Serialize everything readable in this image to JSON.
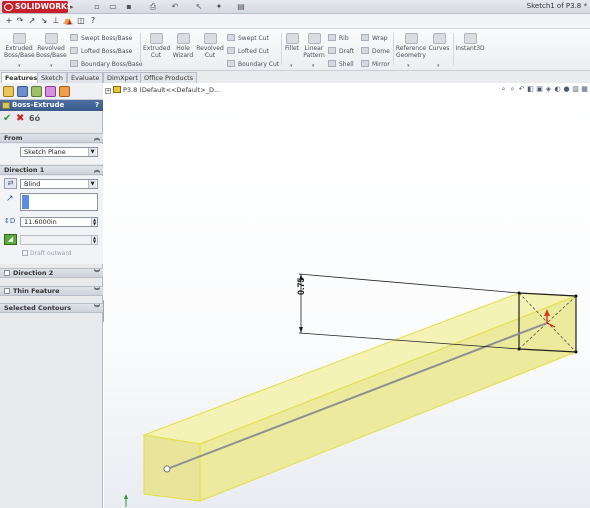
{
  "app": {
    "logo_text": "SOLIDWORKS",
    "document_title": "Sketch1 of P3.8 *",
    "brand_color": "#c8202a"
  },
  "quick_access": [
    {
      "icon": "new-document-icon",
      "glyph": "▫"
    },
    {
      "icon": "open-icon",
      "glyph": "▭"
    },
    {
      "icon": "save-icon",
      "glyph": "▪"
    },
    {
      "icon": "print-icon",
      "glyph": "⎙"
    },
    {
      "icon": "undo-icon",
      "glyph": "↶"
    },
    {
      "icon": "select-icon",
      "glyph": "↖"
    },
    {
      "icon": "rebuild-icon",
      "glyph": "✦"
    },
    {
      "icon": "options-icon",
      "glyph": "▤"
    }
  ],
  "toolbar2": [
    {
      "icon": "add-icon",
      "glyph": "+"
    },
    {
      "icon": "arc-icon",
      "glyph": "↷"
    },
    {
      "icon": "line-icon",
      "glyph": "↗"
    },
    {
      "icon": "trim-icon",
      "glyph": "↘"
    },
    {
      "icon": "dimension-icon",
      "glyph": "⊥"
    },
    {
      "icon": "view-icon",
      "glyph": "⛺"
    },
    {
      "icon": "appearance-icon",
      "glyph": "◫"
    },
    {
      "icon": "help-icon",
      "glyph": "?"
    }
  ],
  "ribbon": {
    "extruded_boss": "Extruded Boss/Base",
    "revolved_boss": "Revolved Boss/Base",
    "swept_boss": "Swept Boss/Base",
    "lofted_boss": "Lofted Boss/Base",
    "boundary_boss": "Boundary Boss/Base",
    "extruded_cut": "Extruded Cut",
    "hole_wizard": "Hole Wizard",
    "revolved_cut": "Revolved Cut",
    "swept_cut": "Swept Cut",
    "lofted_cut": "Lofted Cut",
    "boundary_cut": "Boundary Cut",
    "fillet": "Fillet",
    "linear_pattern": "Linear Pattern",
    "rib": "Rib",
    "draft": "Draft",
    "shell": "Shell",
    "wrap": "Wrap",
    "dome": "Dome",
    "mirror": "Mirror",
    "reference_geometry": "Reference Geometry",
    "curves": "Curves",
    "instant3d": "Instant3D"
  },
  "tabs": [
    "Features",
    "Sketch",
    "Evaluate",
    "DimXpert",
    "Office Products"
  ],
  "active_tab": "Features",
  "property_manager": {
    "title": "Boss-Extrude",
    "help": "?",
    "ok": "✔",
    "cancel": "✖",
    "preview": "6ó",
    "from": {
      "header": "From",
      "value": "Sketch Plane"
    },
    "direction1": {
      "header": "Direction 1",
      "end_condition": "Blind",
      "depth": "11.6000in",
      "draft_outward": "Draft outward"
    },
    "direction2": {
      "header": "Direction 2"
    },
    "thin_feature": {
      "header": "Thin Feature"
    },
    "selected_contours": {
      "header": "Selected Contours"
    }
  },
  "graphics": {
    "tree_text": "P3.8  (Default<<Default>_D...",
    "dimension_value": "0.75",
    "view_tools": [
      "zoom-fit-icon",
      "zoom-area-icon",
      "previous-view-icon",
      "section-view-icon",
      "view-orientation-icon",
      "display-style-icon",
      "hide-show-icon",
      "edit-appearance-icon",
      "scene-icon",
      "view-settings-icon"
    ],
    "preview_color": "#f2f0a8",
    "edge_color": "#e6e04a"
  }
}
